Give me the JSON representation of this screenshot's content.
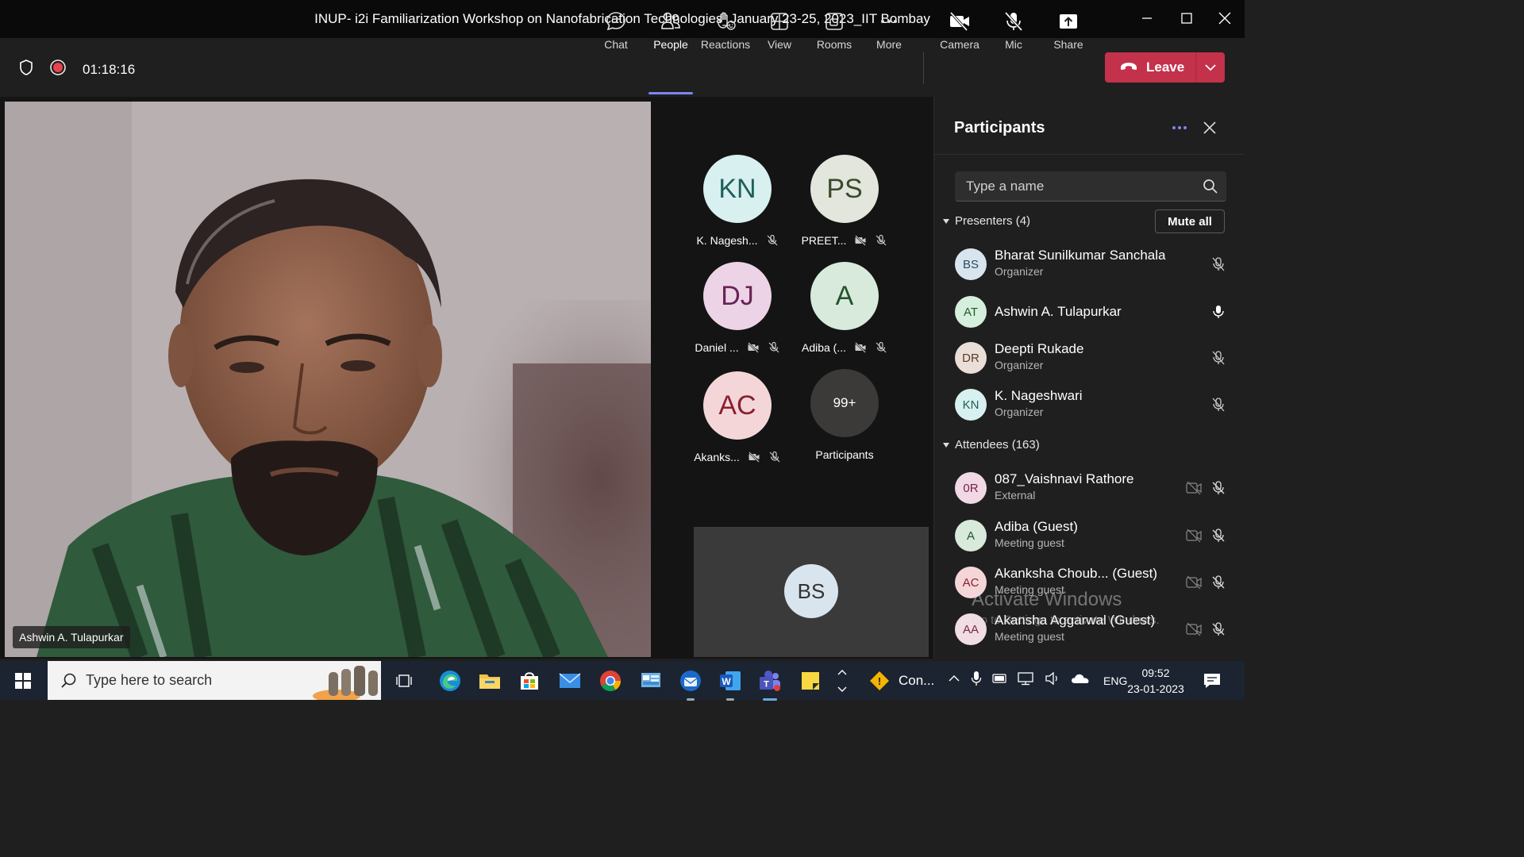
{
  "window": {
    "title": "INUP- i2i Familiarization Workshop on Nanofabrication Technologies_January 23-25, 2023_IIT Bombay"
  },
  "toolbar": {
    "timer": "01:18:16",
    "buttons": [
      {
        "label": "Chat",
        "icon": "chat-icon"
      },
      {
        "label": "People",
        "icon": "people-icon",
        "active": true
      },
      {
        "label": "Reactions",
        "icon": "reactions-icon"
      },
      {
        "label": "View",
        "icon": "view-icon"
      },
      {
        "label": "Rooms",
        "icon": "rooms-icon"
      },
      {
        "label": "More",
        "icon": "more-icon"
      },
      {
        "label": "Camera",
        "icon": "camera-off-icon"
      },
      {
        "label": "Mic",
        "icon": "mic-off-icon"
      },
      {
        "label": "Share",
        "icon": "share-icon"
      }
    ],
    "leave_label": "Leave",
    "leave_color": "#c4314b",
    "accent_color": "#7f85f5"
  },
  "stage": {
    "main_speaker": "Ashwin A. Tulapurkar",
    "gallery": [
      {
        "initials": "KN",
        "name": "K. Nagesh...",
        "bg": "#d8f0ef",
        "fg": "#1f5f5b"
      },
      {
        "initials": "PS",
        "name": "PREET...",
        "bg": "#e2e6dc",
        "fg": "#3b4a2a"
      },
      {
        "initials": "DJ",
        "name": "Daniel ...",
        "bg": "#ecd4e6",
        "fg": "#6a2256"
      },
      {
        "initials": "A",
        "name": "Adiba (...",
        "bg": "#d7eadb",
        "fg": "#24522c"
      },
      {
        "initials": "AC",
        "name": "Akanks...",
        "bg": "#f4d6d9",
        "fg": "#8a1f2d"
      },
      {
        "initials": "99+",
        "name": "Participants",
        "bg": "#3b3a39",
        "fg": "#ffffff"
      }
    ],
    "self_view_initials": "BS"
  },
  "panel": {
    "title": "Participants",
    "search_placeholder": "Type a name",
    "presenters_header": "Presenters (4)",
    "mute_all": "Mute all",
    "attendees_header": "Attendees (163)",
    "presenters": [
      {
        "initials": "BS",
        "name": "Bharat Sunilkumar Sanchala",
        "role": "Organizer",
        "bg": "#d9e5ee",
        "fg": "#2b4a63",
        "mic": "muted"
      },
      {
        "initials": "AT",
        "name": "Ashwin A. Tulapurkar",
        "role": "",
        "bg": "#d6efdc",
        "fg": "#1e5b2b",
        "mic": "on"
      },
      {
        "initials": "DR",
        "name": "Deepti Rukade",
        "role": "Organizer",
        "bg": "#eadfd8",
        "fg": "#5b3a26",
        "mic": "muted"
      },
      {
        "initials": "KN",
        "name": "K. Nageshwari",
        "role": "Organizer",
        "bg": "#d8f0ef",
        "fg": "#1f5f5b",
        "mic": "muted"
      }
    ],
    "attendees": [
      {
        "initials": "0R",
        "name": "087_Vaishnavi Rathore",
        "role": "External",
        "bg": "#f0d8e4",
        "fg": "#7a1f4c"
      },
      {
        "initials": "A",
        "name": "Adiba (Guest)",
        "role": "Meeting guest",
        "bg": "#d7eadb",
        "fg": "#24522c"
      },
      {
        "initials": "AC",
        "name": "Akanksha Choub... (Guest)",
        "role": "Meeting guest",
        "bg": "#f4d6d9",
        "fg": "#8a1f2d"
      },
      {
        "initials": "AA",
        "name": "Akansha Aggarwal (Guest)",
        "role": "Meeting guest",
        "bg": "#f1dde4",
        "fg": "#7a2a45"
      }
    ],
    "watermark_title": "Activate Windows",
    "watermark_sub": "Go to Settings to activate Windows."
  },
  "taskbar": {
    "search_placeholder": "Type here to search",
    "pinned": [
      "task-view-icon",
      "edge-icon",
      "file-explorer-icon",
      "store-icon",
      "mail-icon",
      "chrome-icon",
      "control-panel-icon",
      "thunderbird-icon",
      "word-icon",
      "teams-icon",
      "sticky-notes-icon"
    ],
    "running_label": "Con...",
    "language": "ENG",
    "time": "09:52",
    "date": "23-01-2023"
  }
}
